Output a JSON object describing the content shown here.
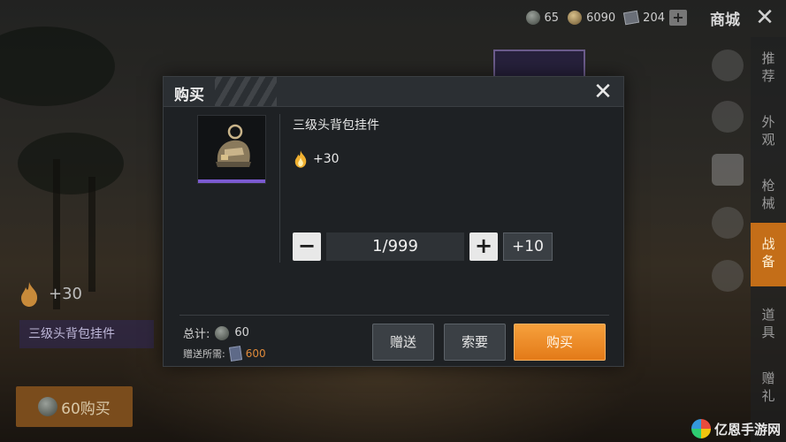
{
  "topbar": {
    "silver_coins": "65",
    "bp_coins": "6090",
    "vouchers": "204",
    "shop_title": "商城"
  },
  "right_nav": {
    "items": [
      "推荐",
      "外观",
      "枪械",
      "战备",
      "道具",
      "赠礼"
    ],
    "active_index": 3
  },
  "background_panel": {
    "flame_bonus": "+30",
    "item_name": "三级头背包挂件",
    "buy_label": "60购买"
  },
  "modal": {
    "title": "购买",
    "item_name": "三级头背包挂件",
    "flame_bonus": "+30",
    "quantity_minus": "−",
    "quantity_value": "1/999",
    "quantity_plus": "+",
    "quantity_plus10": "+10",
    "total_label": "总计:",
    "total_value": "60",
    "gift_label": "赠送所需:",
    "gift_value": "600",
    "gift_button": "赠送",
    "request_button": "索要",
    "buy_button": "购买"
  },
  "watermark": "亿恩手游网",
  "colors": {
    "accent_orange": "#e37a18",
    "rarity_purple": "#7b5ad0",
    "modal_bg": "#1e2124"
  }
}
